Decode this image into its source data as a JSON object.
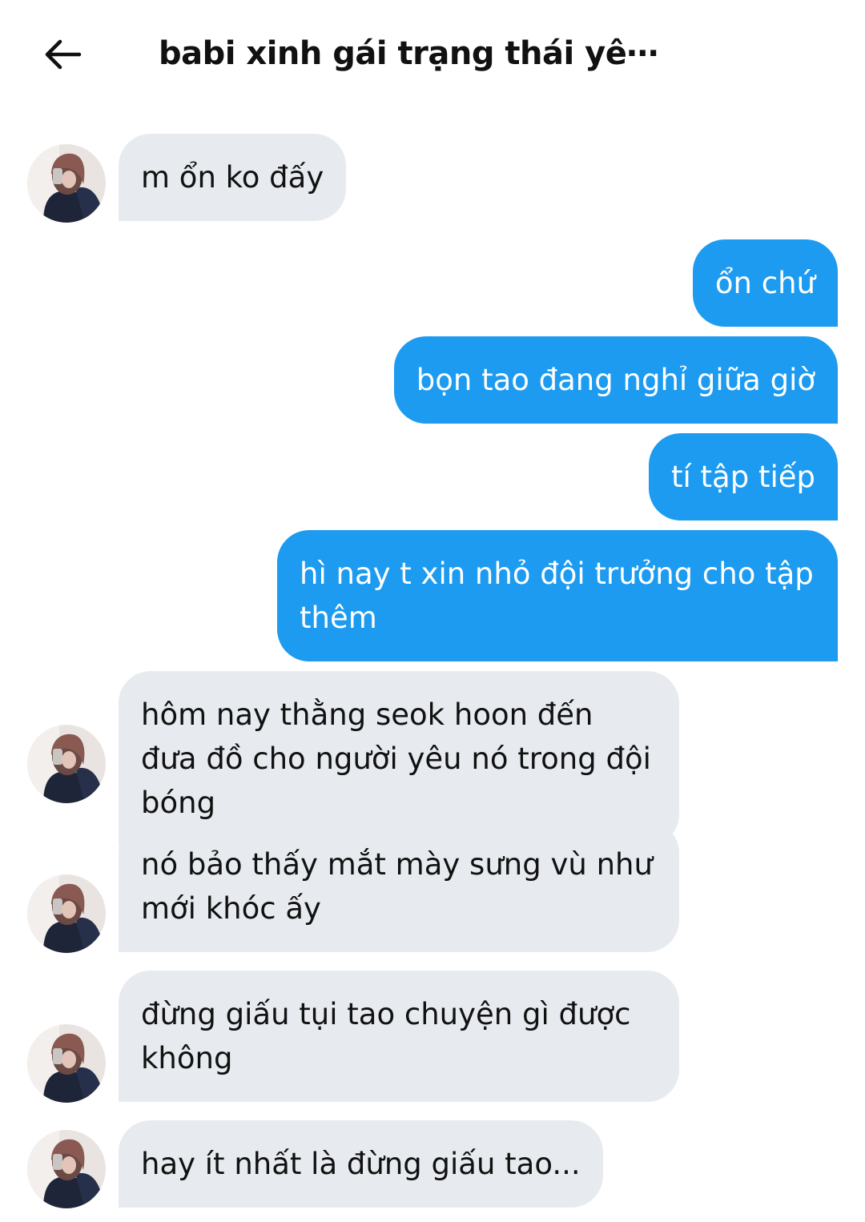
{
  "header": {
    "title": "babi xinh gái trạng thái yê⋯",
    "back_icon": "arrow-left-icon"
  },
  "colors": {
    "incoming_bubble": "#e7ebef",
    "outgoing_bubble": "#1d9bf0",
    "outgoing_text": "#ffffff",
    "incoming_text": "#111111"
  },
  "messages": [
    {
      "direction": "incoming",
      "text": "m ổn ko đấy",
      "avatar": true
    },
    {
      "direction": "outgoing",
      "text": "ổn chứ"
    },
    {
      "direction": "outgoing",
      "text": "bọn tao đang nghỉ giữa giờ"
    },
    {
      "direction": "outgoing",
      "text": "tí tập tiếp"
    },
    {
      "direction": "outgoing",
      "text": "hì nay t xin nhỏ đội trưởng cho tập thêm"
    },
    {
      "direction": "incoming",
      "text": "hôm nay thằng seok hoon đến đưa đồ cho người yêu nó trong đội bóng",
      "avatar": true
    },
    {
      "direction": "incoming",
      "text": "nó bảo thấy mắt mày sưng vù như mới khóc ấy",
      "avatar": true
    },
    {
      "direction": "incoming",
      "text": "đừng giấu tụi tao chuyện gì được không",
      "avatar": true
    },
    {
      "direction": "incoming",
      "text": "hay ít nhất là đừng giấu tao...",
      "avatar": true
    }
  ]
}
